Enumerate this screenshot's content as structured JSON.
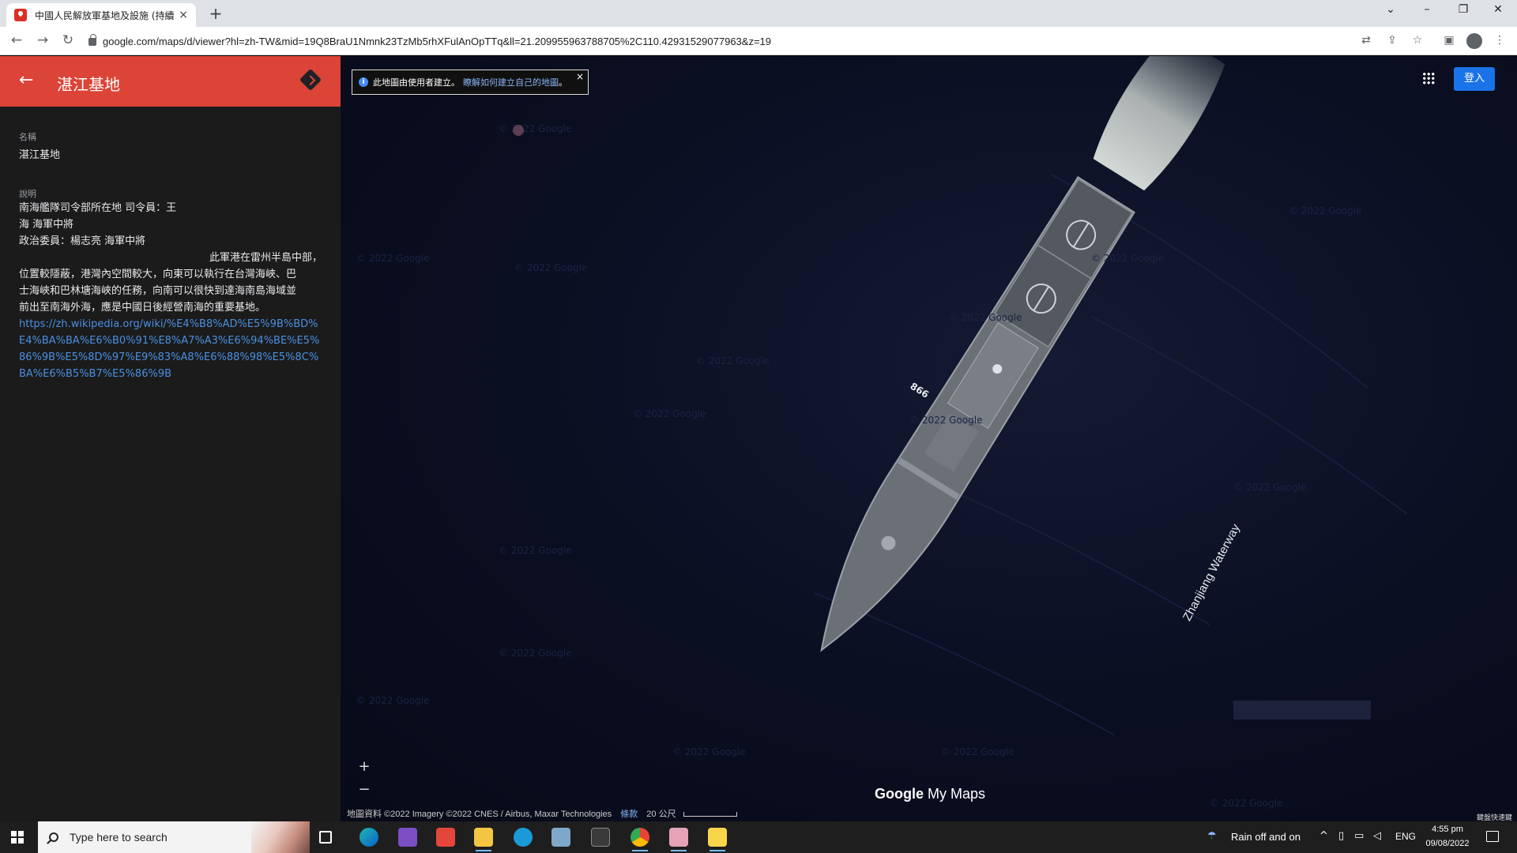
{
  "browser": {
    "tab_title": "中國人民解放軍基地及設施 (持續",
    "tab_close": "×",
    "new_tab": "+",
    "window_controls": [
      "⌄",
      "–",
      "❐",
      "✕"
    ],
    "url": "google.com/maps/d/viewer?hl=zh-TW&mid=19Q8BraU1Nmnk23TzMb5rhXFulAnOpTTq&ll=21.209955963788705%2C110.42931529077963&z=19",
    "nav": {
      "back": "←",
      "forward": "→",
      "reload": "↻"
    },
    "toolbar_icons": [
      "translate-icon",
      "share-icon",
      "bookmark-star-icon",
      "sidebar-icon",
      "profile-icon",
      "menu-icon"
    ],
    "toolbar_glyphs": {
      "translate": "⇄",
      "share": "⇪",
      "star": "☆",
      "sidebar": "▣",
      "menu": "⋮"
    }
  },
  "panel": {
    "header_color": "#db4437",
    "back": "←",
    "title": "湛江基地",
    "name_label": "名稱",
    "name_value": "湛江基地",
    "desc_label": "說明",
    "desc_lines": [
      "南海艦隊司令部所在地                              司令員：王",
      "海 海軍中將",
      "政治委員：楊志亮 海軍中將",
      "此軍港在雷州半島中部，",
      "位置較隱蔽，港灣內空間較大，向東可以執行在台灣海峽、巴",
      "士海峽和巴林塘海峽的任務，向南可以很快到達海南島海域並",
      "前出至南海外海，應是中國日後經營南海的重要基地。"
    ],
    "link": "https://zh.wikipedia.org/wiki/%E4%B8%AD%E5%9B%BD%E4%BA%BA%E6%B0%91%E8%A7%A3%E6%94%BE%E5%86%9B%E5%8D%97%E9%83%A8%E6%88%98%E5%8C%BA%E6%B5%B7%E5%86%9B"
  },
  "map": {
    "notice_text": "此地圖由使用者建立。",
    "notice_link": "瞭解如何建立自己的地圖",
    "notice_suffix": "。",
    "notice_close": "×",
    "info_glyph": "i",
    "signin": "登入",
    "zoom_in": "+",
    "zoom_out": "−",
    "brand_google": "Google",
    "brand_mymaps": "My Maps",
    "attribution": "地圖資料 ©2022 Imagery ©2022 CNES / Airbus, Maxar Technologies",
    "terms": "條款",
    "scale": "20 公尺",
    "shortcuts": "鍵盤快速鍵",
    "waterway_label": "Zhanjiang Waterway",
    "watermark": "© 2022 Google",
    "ship_number": "866",
    "accent": "#1a73e8"
  },
  "taskbar": {
    "search_placeholder": "Type here to search",
    "weather": "Rain off and on",
    "lang": "ENG",
    "time": "4:55 pm",
    "date": "09/08/2022",
    "apps": [
      "task-view-icon",
      "edge-icon",
      "visual-studio-icon",
      "anydesk-icon",
      "file-explorer-icon",
      "skype-icon",
      "app-icon",
      "terminal-icon",
      "chrome-icon",
      "snipping-icon",
      "sticky-notes-icon"
    ]
  }
}
